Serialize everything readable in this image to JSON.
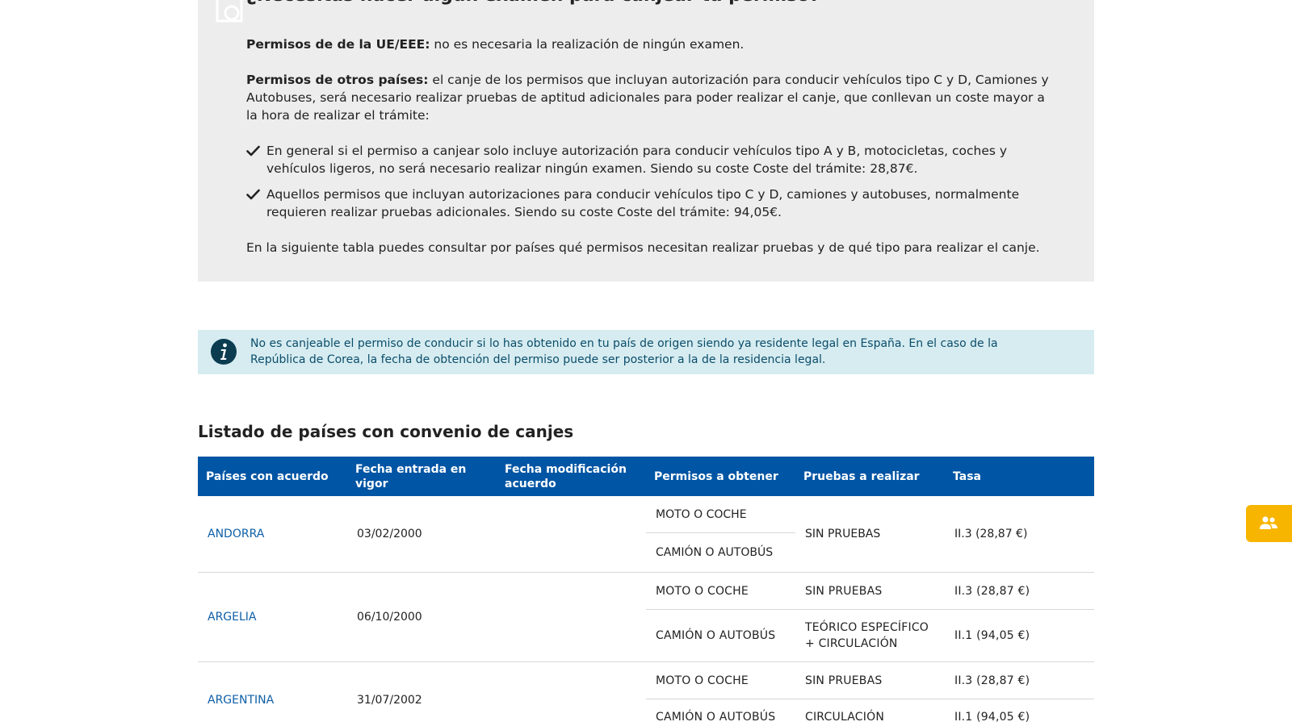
{
  "exam_section": {
    "title": "¿Necesitas hacer algún examen para canjear tu permiso?",
    "p1_bold": "Permisos de de la UE/EEE:",
    "p1_text": " no es necesaria la realización de ningún examen.",
    "p2_bold": "Permisos de otros países:",
    "p2_text": " el canje de los permisos que incluyan autorización para conducir vehículos tipo C y D, Camiones y Autobuses, será necesario realizar pruebas de aptitud adicionales para poder realizar el canje, que conllevan un coste mayor a la hora de realizar el trámite:",
    "bullets": [
      "En general si el permiso a canjear solo incluye autorización para conducir vehículos tipo A y B, motocicletas, coches y vehículos ligeros, no será necesario realizar ningún examen. Siendo su coste Coste del trámite: 28,87€.",
      "Aquellos permisos que incluyan autorizaciones para conducir vehículos tipo C y D, camiones y autobuses, normalmente requieren realizar pruebas adicionales. Siendo su coste Coste del trámite: 94,05€."
    ],
    "p3": "En la siguiente tabla puedes consultar por países qué permisos necesitan realizar pruebas y de qué tipo para realizar el canje."
  },
  "info_box": {
    "text": "No es canjeable el permiso de conducir si lo has obtenido en tu país de origen siendo ya residente legal en España. En el caso de la República de Corea, la fecha de obtención del permiso puede ser posterior a la de la residencia legal."
  },
  "table": {
    "title": "Listado de países con convenio de canjes",
    "headers": [
      "Países con acuerdo",
      "Fecha entrada en vigor",
      "Fecha modificación acuerdo",
      "Permisos a obtener",
      "Pruebas a realizar",
      "Tasa"
    ],
    "rows": [
      {
        "country": "ANDORRA",
        "date_in_force": "03/02/2000",
        "date_modified": "",
        "permit_1": "MOTO O COCHE",
        "permit_2": "CAMIÓN O AUTOBÚS",
        "tests": "SIN PRUEBAS",
        "fee": "II.3 (28,87 €)"
      },
      {
        "country": "ARGELIA",
        "date_in_force": "06/10/2000",
        "date_modified": "",
        "permit_1": "MOTO O COCHE",
        "tests_1": "SIN PRUEBAS",
        "fee_1": "II.3 (28,87 €)",
        "permit_2": "CAMIÓN O AUTOBÚS",
        "tests_2": "TEÓRICO ESPECÍFICO + CIRCULACIÓN",
        "fee_2": "II.1 (94,05 €)"
      },
      {
        "country": "ARGENTINA",
        "date_in_force": "31/07/2002",
        "date_modified": "",
        "permit_1": "MOTO O COCHE",
        "tests_1": "SIN PRUEBAS",
        "fee_1": "II.3 (28,87 €)",
        "permit_2": "CAMIÓN O AUTOBÚS",
        "tests_2": "CIRCULACIÓN",
        "fee_2": "II.1 (94,05 €)"
      }
    ]
  },
  "colors": {
    "table_header": "#0055a4",
    "info_bg": "#d6ecf0",
    "exam_bg": "#ededed",
    "float_tab": "#f7b500",
    "link": "#0f5fa6"
  },
  "icons": {
    "exam": "document-icon",
    "bullet": "check-icon",
    "info": "info-icon",
    "float_tab": "people-icon"
  }
}
